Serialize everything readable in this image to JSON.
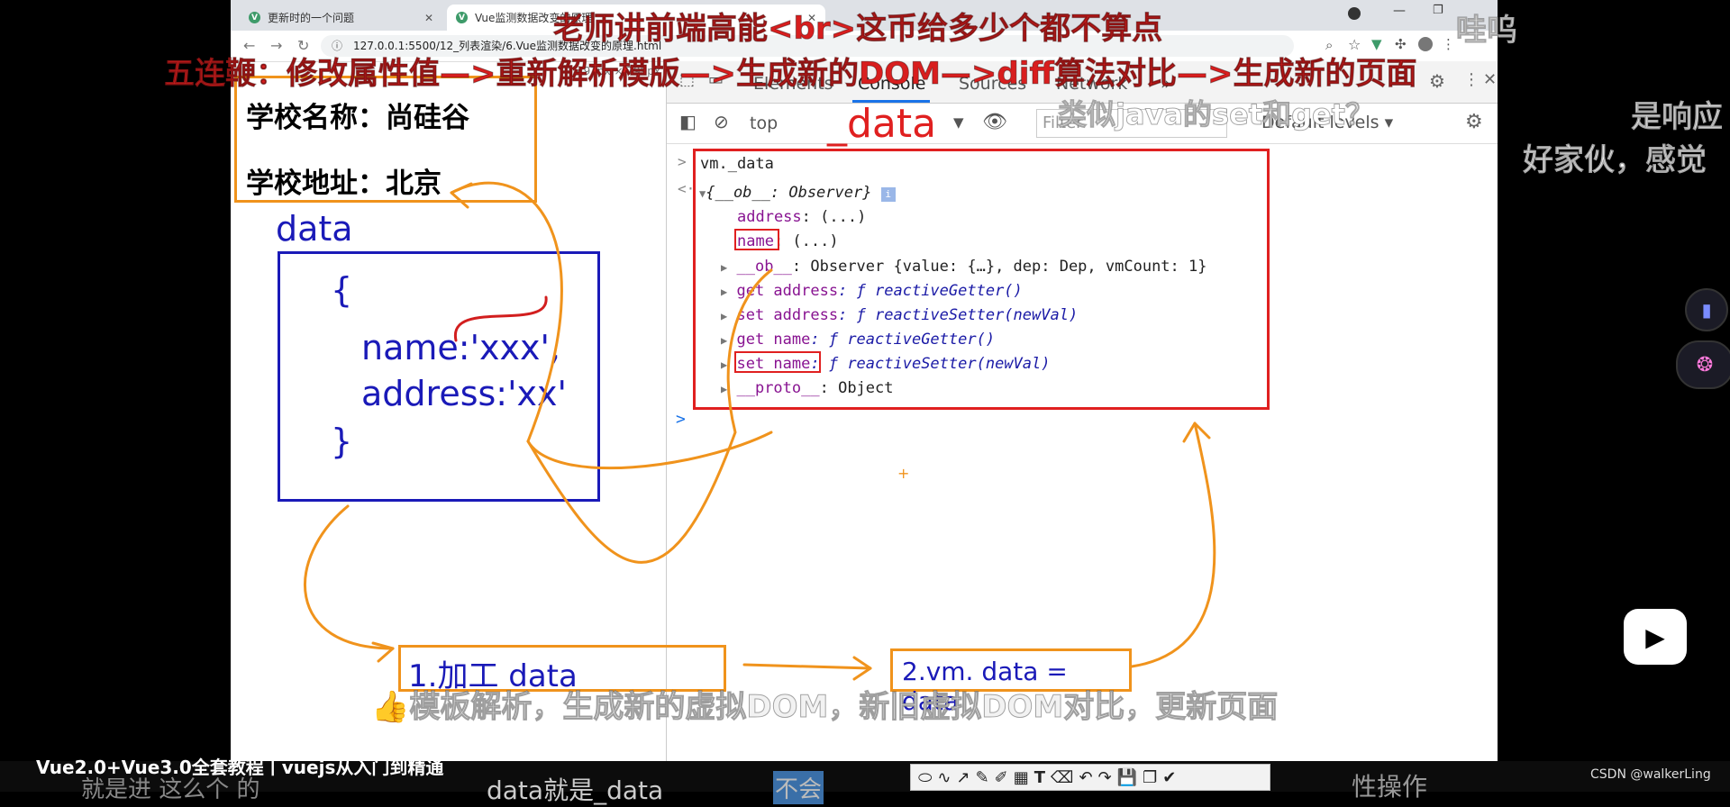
{
  "browser": {
    "tabs": [
      {
        "title": "更新时的一个问题",
        "active": false
      },
      {
        "title": "Vue监测数据改变的原理",
        "active": true
      }
    ],
    "url": "127.0.0.1:5500/12_列表渲染/6.Vue监测数据改变的原理.html",
    "size_indicator": "493px × 799px"
  },
  "page": {
    "school_name": "学校名称：尚硅谷",
    "school_address": "学校地址：北京",
    "data_label": "data",
    "brace_open": "{",
    "line_name": "name:'xxx',",
    "line_address": "address:'xx'",
    "brace_close": "}"
  },
  "devtools": {
    "tabs": [
      "Elements",
      "Console",
      "Sources",
      "Network",
      "»"
    ],
    "active_tab": "Console",
    "context": "top",
    "filter_placeholder": "Filter",
    "levels": "Default levels ▾",
    "console": {
      "input": "vm._data",
      "result": "{__ob__: Observer}",
      "props": [
        {
          "key": "address",
          "rest": ": (...)"
        },
        {
          "key": "name",
          "rest": ": (...)"
        },
        {
          "key": "__ob__",
          "rest": ": Observer {value: {…}, dep: Dep, vmCount: 1}"
        },
        {
          "key": "get address",
          "rest": ": ƒ reactiveGetter()"
        },
        {
          "key": "set address",
          "rest": ": ƒ reactiveSetter(newVal)"
        },
        {
          "key": "get name",
          "rest": ": ƒ reactiveGetter()"
        },
        {
          "key": "set name",
          "rest": ": ƒ reactiveSetter(newVal)"
        },
        {
          "key": "__proto__",
          "rest": ": Object"
        }
      ]
    }
  },
  "annotations": {
    "underscore_data": "_data",
    "step1": "1.加工 data",
    "step2": "2.vm. data = data"
  },
  "danmaku": [
    "老师讲前端高能<br>这币给多少个都不算点",
    "哇呜",
    "五连鞭：修改属性值—>重新解析模版—>生成新的DOM—>diff算法对比—>生成新的页面",
    "类似java的set和get？",
    "是响应",
    "好家伙，感觉",
    "模板解析，生成新的虚拟DOM，新旧虚拟DOM对比，更新页面"
  ],
  "video": {
    "title": "Vue2.0+Vue3.0全套教程丨vuejs从入门到精通",
    "subtitle_left": "就是进 这么个 的",
    "subtitle_mid": "data就是_data",
    "subtitle_right": "不会",
    "subtitle_far": "性操作",
    "watermark": "CSDN @walkerLing"
  },
  "colors": {
    "orange": "#f0931c",
    "blue": "#1a1ab8",
    "red": "#e02020",
    "danmaku_red": "#d81e1e"
  }
}
